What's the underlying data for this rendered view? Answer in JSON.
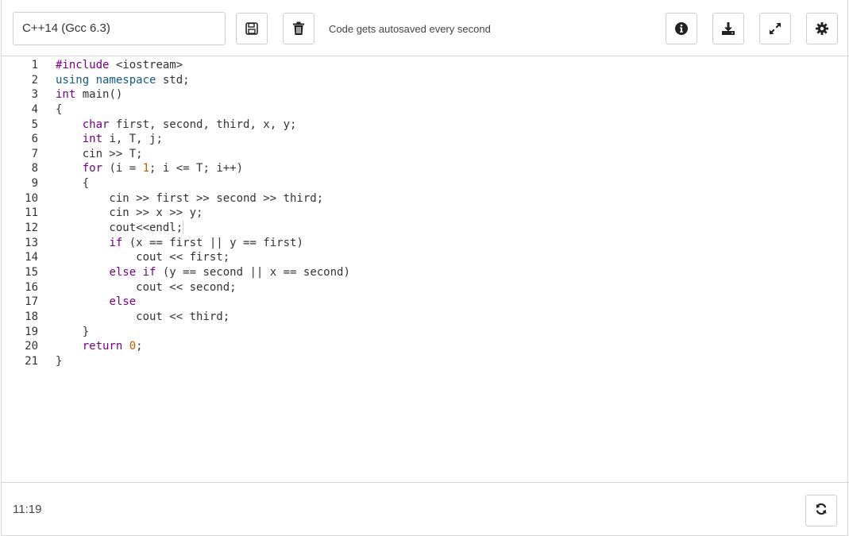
{
  "toolbar": {
    "language": "C++14 (Gcc 6.3)",
    "autosave_text": "Code gets autosaved every second"
  },
  "icons": [
    "save-icon",
    "trash-icon",
    "info-icon",
    "download-icon",
    "expand-icon",
    "gear-icon",
    "refresh-icon"
  ],
  "editor": {
    "lines": [
      {
        "n": "1",
        "code": "#include <iostream>"
      },
      {
        "n": "2",
        "code": "using namespace std;"
      },
      {
        "n": "3",
        "code": "int main()"
      },
      {
        "n": "4",
        "code": "{"
      },
      {
        "n": "5",
        "code": "    char first, second, third, x, y;"
      },
      {
        "n": "6",
        "code": "    int i, T, j;"
      },
      {
        "n": "7",
        "code": "    cin >> T;"
      },
      {
        "n": "8",
        "code": "    for (i = 1; i <= T; i++)"
      },
      {
        "n": "9",
        "code": "    {"
      },
      {
        "n": "10",
        "code": "        cin >> first >> second >> third;"
      },
      {
        "n": "11",
        "code": "        cin >> x >> y;"
      },
      {
        "n": "12",
        "code": "        cout<<endl;"
      },
      {
        "n": "13",
        "code": "        if (x == first || y == first)"
      },
      {
        "n": "14",
        "code": "            cout << first;"
      },
      {
        "n": "15",
        "code": "        else if (y == second || x == second)"
      },
      {
        "n": "16",
        "code": "            cout << second;"
      },
      {
        "n": "17",
        "code": "        else"
      },
      {
        "n": "18",
        "code": "            cout << third;"
      },
      {
        "n": "19",
        "code": "    }"
      },
      {
        "n": "20",
        "code": "    return 0;"
      },
      {
        "n": "21",
        "code": "}"
      }
    ]
  },
  "footer": {
    "cursor_position": "11:19"
  }
}
